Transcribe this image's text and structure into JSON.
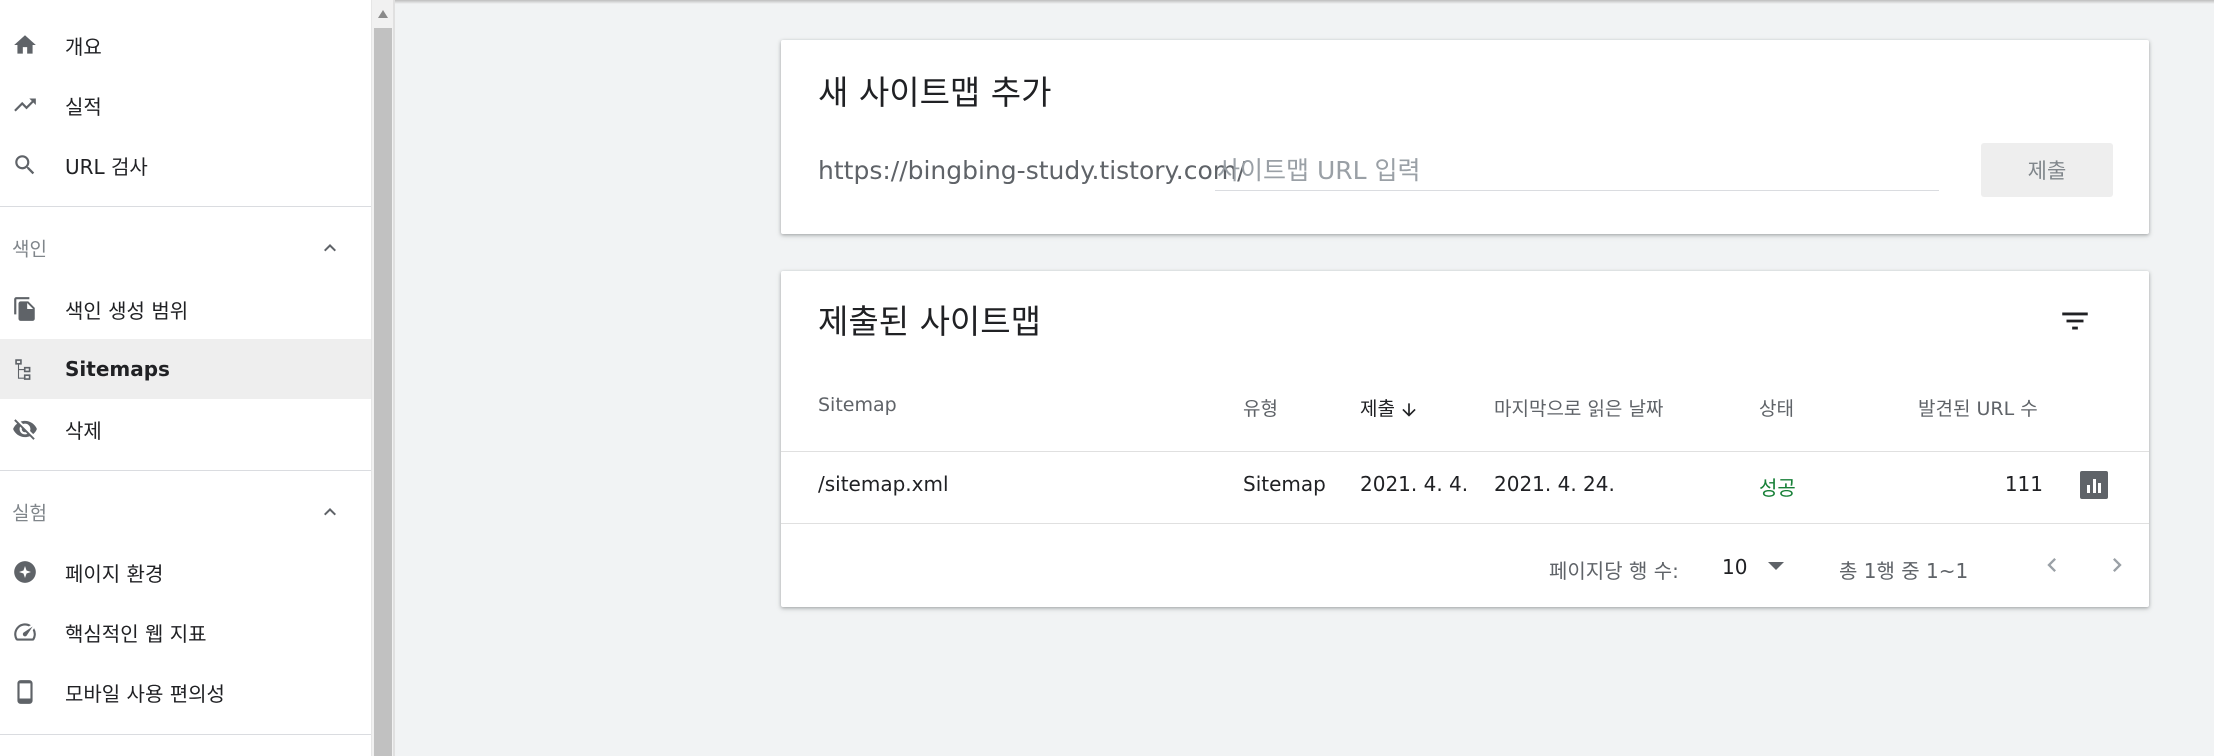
{
  "sidebar": {
    "items_top": [
      {
        "label": "개요",
        "icon": "home-icon"
      },
      {
        "label": "실적",
        "icon": "trending-up-icon"
      },
      {
        "label": "URL 검사",
        "icon": "search-icon"
      }
    ],
    "index_section": {
      "label": "색인",
      "items": [
        {
          "label": "색인 생성 범위",
          "icon": "copy-icon"
        },
        {
          "label": "Sitemaps",
          "icon": "sitemap-icon",
          "active": true
        },
        {
          "label": "삭제",
          "icon": "visibility-off-icon"
        }
      ]
    },
    "experience_section": {
      "label": "실험",
      "items": [
        {
          "label": "페이지 환경",
          "icon": "page-experience-icon"
        },
        {
          "label": "핵심적인 웹 지표",
          "icon": "speed-gauge-icon"
        },
        {
          "label": "모바일 사용 편의성",
          "icon": "smartphone-icon"
        }
      ]
    }
  },
  "add_sitemap": {
    "title": "새 사이트맵 추가",
    "url_prefix": "https://bingbing-study.tistory.com/",
    "input_value": "",
    "input_placeholder": "사이트맵 URL 입력",
    "submit_label": "제출"
  },
  "submitted_sitemaps": {
    "title": "제출된 사이트맵",
    "columns": {
      "sitemap": "Sitemap",
      "type": "유형",
      "submitted": "제출",
      "last_read": "마지막으로 읽은 날짜",
      "status": "상태",
      "discovered_urls": "발견된 URL 수"
    },
    "rows": [
      {
        "sitemap": "/sitemap.xml",
        "type": "Sitemap",
        "submitted": "2021. 4. 4.",
        "last_read": "2021. 4. 24.",
        "status": "성공",
        "discovered_urls": "111"
      }
    ],
    "pagination": {
      "rows_per_page_label": "페이지당 행 수:",
      "rows_per_page_value": "10",
      "range_label": "총 1행 중 1~1"
    }
  },
  "colors": {
    "status_success": "#188038",
    "active_nav_bg": "#eeeeee",
    "page_bg": "#f1f3f4"
  }
}
